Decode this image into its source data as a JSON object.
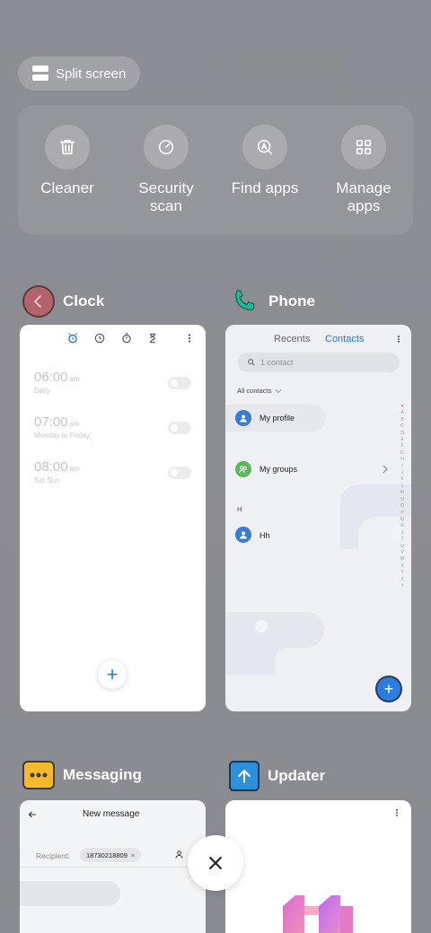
{
  "split_screen": {
    "label": "Split screen"
  },
  "quick_actions": [
    {
      "label": "Cleaner",
      "icon": "trash-icon"
    },
    {
      "label": "Security\nscan",
      "icon": "security-scan-icon"
    },
    {
      "label": "Find apps",
      "icon": "find-apps-icon"
    },
    {
      "label": "Manage\napps",
      "icon": "grid-icon"
    }
  ],
  "apps": {
    "clock": {
      "name": "Clock",
      "alarms": [
        {
          "time": "06:00",
          "ampm": "am",
          "repeat": "Daily"
        },
        {
          "time": "07:00",
          "ampm": "am",
          "repeat": "Monday to Friday"
        },
        {
          "time": "08:00",
          "ampm": "am",
          "repeat": "Sat Sun"
        }
      ]
    },
    "phone": {
      "name": "Phone",
      "tabs": [
        "Recents",
        "Contacts"
      ],
      "active_tab": "Contacts",
      "search_placeholder": "1 contact",
      "filter": "All contacts",
      "rows": {
        "profile": "My profile",
        "groups": "My groups",
        "section": "H",
        "contact": "Hh"
      },
      "alphabet": [
        "♥",
        "A",
        "B",
        "C",
        "D",
        "E",
        "F",
        "G",
        "H",
        "I",
        "J",
        "K",
        "L",
        "M",
        "N",
        "O",
        "P",
        "Q",
        "R",
        "S",
        "T",
        "U",
        "V",
        "W",
        "X",
        "Y",
        "Z",
        "#"
      ]
    },
    "messaging": {
      "name": "Messaging",
      "title": "New message",
      "recipient_label": "Recipient:",
      "recipient": "18730218809"
    },
    "updater": {
      "name": "Updater"
    }
  },
  "colors": {
    "accent": "#1e7be8",
    "clock_icon": "#b4636a",
    "phone_icon": "#1fb89a",
    "messaging_icon": "#f7b82c",
    "updater_icon": "#2c90dd"
  }
}
